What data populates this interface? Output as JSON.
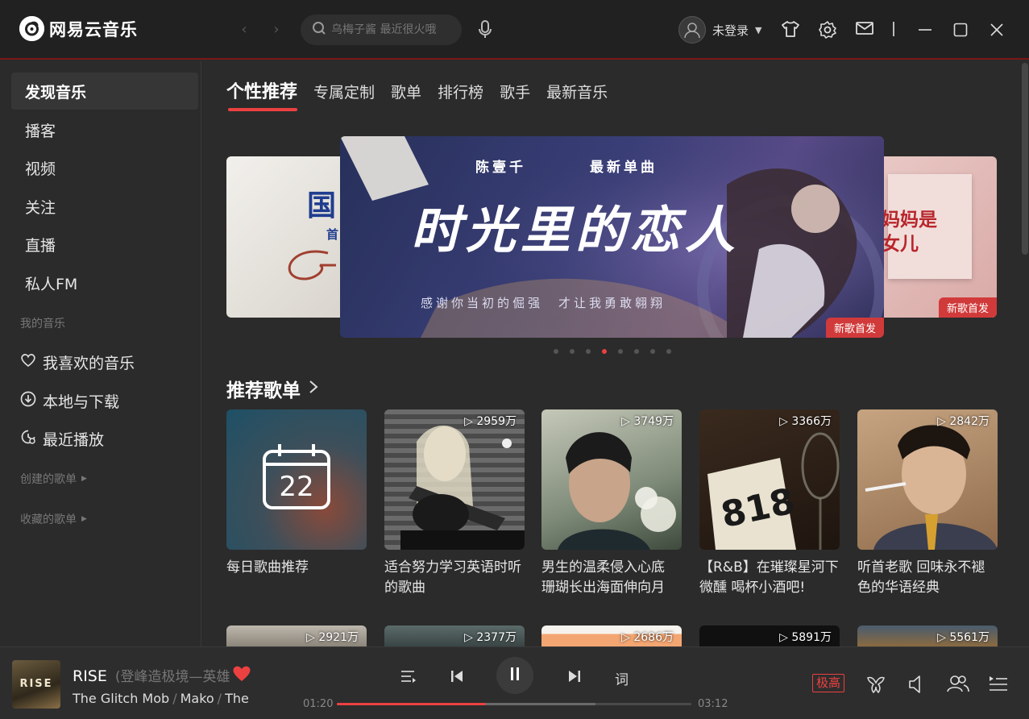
{
  "app": {
    "name": "网易云音乐"
  },
  "search": {
    "placeholder": "乌梅子酱 最近很火哦"
  },
  "user": {
    "name": "未登录"
  },
  "sidebar": {
    "items": [
      {
        "label": "发现音乐"
      },
      {
        "label": "播客"
      },
      {
        "label": "视频"
      },
      {
        "label": "关注"
      },
      {
        "label": "直播"
      },
      {
        "label": "私人FM"
      }
    ],
    "my_music_header": "我的音乐",
    "my_music": [
      {
        "label": "我喜欢的音乐",
        "icon": "heart-icon"
      },
      {
        "label": "本地与下载",
        "icon": "download-icon"
      },
      {
        "label": "最近播放",
        "icon": "recent-icon"
      }
    ],
    "created_header": "创建的歌单",
    "collected_header": "收藏的歌单"
  },
  "tabs": [
    "个性推荐",
    "专属定制",
    "歌单",
    "排行榜",
    "歌手",
    "最新音乐"
  ],
  "banner": {
    "artist": "陈壹千",
    "tag": "最新单曲",
    "title": "时光里的恋人",
    "lyric": "感谢你当初的倔强　才让我勇敢翱翔",
    "badge": "新歌首发",
    "right_text": "妈妈是女儿",
    "right_badge": "新歌首发",
    "left_text": "国",
    "left_sub": "首",
    "dots": 8,
    "active_dot": 3
  },
  "recommend": {
    "title": "推荐歌单",
    "cards": [
      {
        "title": "每日歌曲推荐",
        "plays": "",
        "calendar_day": "22"
      },
      {
        "title": "适合努力学习英语时听的歌曲",
        "plays": "2959万"
      },
      {
        "title": "男生的温柔侵入心底 珊瑚长出海面伸向月",
        "plays": "3749万"
      },
      {
        "title": "【R&B】在璀璨星河下微醺 喝杯小酒吧!",
        "plays": "3366万"
      },
      {
        "title": "听首老歌 回味永不褪色的华语经典",
        "plays": "2842万"
      }
    ],
    "row2_plays": [
      "2921万",
      "2377万",
      "2686万",
      "5891万",
      "5561万"
    ]
  },
  "player": {
    "title": "RISE",
    "subtitle": "(登峰造极境—英雄联盟全球总决赛主题曲)",
    "artists": [
      "The Glitch Mob",
      "Mako",
      "The Word Alive"
    ],
    "current_time": "01:20",
    "total_time": "03:12",
    "progress": 0.42,
    "lyrics_label": "词",
    "quality": "极高",
    "cover_text": "RISE"
  },
  "colors": {
    "accent": "#ec4141",
    "bg": "#2b2b2b",
    "titlebar": "#212121"
  }
}
